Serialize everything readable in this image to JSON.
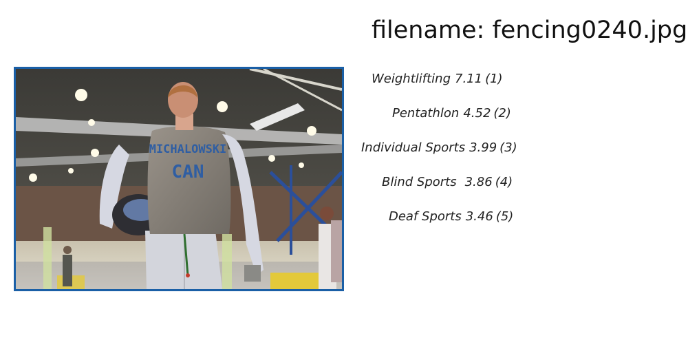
{
  "header": {
    "filename_label": "filename: fencing0240.jpg"
  },
  "image": {
    "border_color": "#1a5fa6",
    "vest_text": "MICHALOWSKI",
    "vest_country": "CAN"
  },
  "predictions": [
    {
      "label": "Weightlifting",
      "score": "7.11",
      "rank": "(1)"
    },
    {
      "label": "Pentathlon",
      "score": "4.52",
      "rank": "(2)"
    },
    {
      "label": "Individual Sports",
      "score": "3.99",
      "rank": "(3)"
    },
    {
      "label": "Blind Sports",
      "score": "3.86",
      "rank": "(4)"
    },
    {
      "label": "Deaf Sports",
      "score": "3.46",
      "rank": "(5)"
    }
  ]
}
